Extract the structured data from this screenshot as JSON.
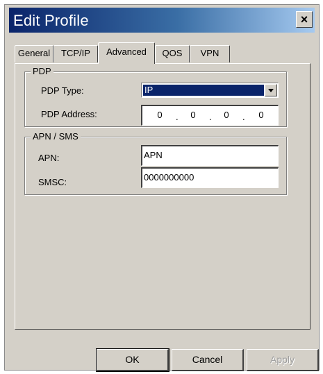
{
  "window": {
    "title": "Edit Profile",
    "close_glyph": "✕"
  },
  "tabs": [
    {
      "label": "General",
      "active": false
    },
    {
      "label": "TCP/IP",
      "active": false
    },
    {
      "label": "Advanced",
      "active": true
    },
    {
      "label": "QOS",
      "active": false
    },
    {
      "label": "VPN",
      "active": false
    }
  ],
  "pdp": {
    "group_label": "PDP",
    "type_label": "PDP Type:",
    "type_value": "IP",
    "address_label": "PDP Address:",
    "address_octets": [
      "0",
      "0",
      "0",
      "0"
    ]
  },
  "apn_sms": {
    "group_label": "APN / SMS",
    "apn_label": "APN:",
    "apn_value": "APN",
    "smsc_label": "SMSC:",
    "smsc_value": "0000000000"
  },
  "buttons": {
    "ok": "OK",
    "cancel": "Cancel",
    "apply": "Apply"
  },
  "colors": {
    "titlebar_start": "#0a246a",
    "titlebar_end": "#a6caf0",
    "dialog_face": "#d4d0c8",
    "selection": "#0a246a"
  }
}
